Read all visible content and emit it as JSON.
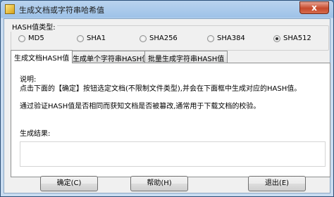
{
  "window": {
    "title": "生成文档或字符串哈希值",
    "close_glyph": "x"
  },
  "hash_group": {
    "label": "HASH值类型:",
    "options": [
      {
        "label": "MD5",
        "selected": false
      },
      {
        "label": "SHA1",
        "selected": false
      },
      {
        "label": "SHA256",
        "selected": false
      },
      {
        "label": "SHA384",
        "selected": false
      },
      {
        "label": "SHA512",
        "selected": true
      }
    ]
  },
  "tabs": [
    {
      "label": "生成文档HASH值",
      "active": true
    },
    {
      "label": "生成单个字符串HASH值",
      "active": false
    },
    {
      "label": "批量生成字符串HASH值",
      "active": false
    }
  ],
  "panel": {
    "heading": "说明:",
    "line1": "点击下面的【确定】按钮选定文档(不限制文件类型),并会在下面框中生成对应的HASH值。",
    "line2": "通过验证HASH值是否相同而获知文档是否被篡改,通常用于下载文档的校验。",
    "result_label": "生成结果:",
    "result_value": ""
  },
  "buttons": {
    "ok": "确定(C)",
    "help": "帮助(H)",
    "exit": "退出(E)"
  }
}
